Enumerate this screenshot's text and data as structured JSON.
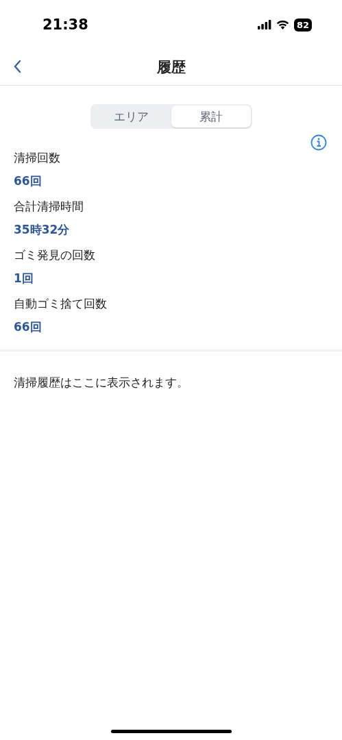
{
  "status_bar": {
    "time": "21:38",
    "battery": "82"
  },
  "nav": {
    "title": "履歴"
  },
  "segments": [
    {
      "label": "エリア",
      "selected": false
    },
    {
      "label": "累計",
      "selected": true
    }
  ],
  "stats": [
    {
      "label": "清掃回数",
      "value": "66回"
    },
    {
      "label": "合計清掃時間",
      "value": "35時32分"
    },
    {
      "label": "ゴミ発見の回数",
      "value": "1回"
    },
    {
      "label": "自動ゴミ捨て回数",
      "value": "66回"
    }
  ],
  "history_message": "清掃履歴はここに表示されます。"
}
